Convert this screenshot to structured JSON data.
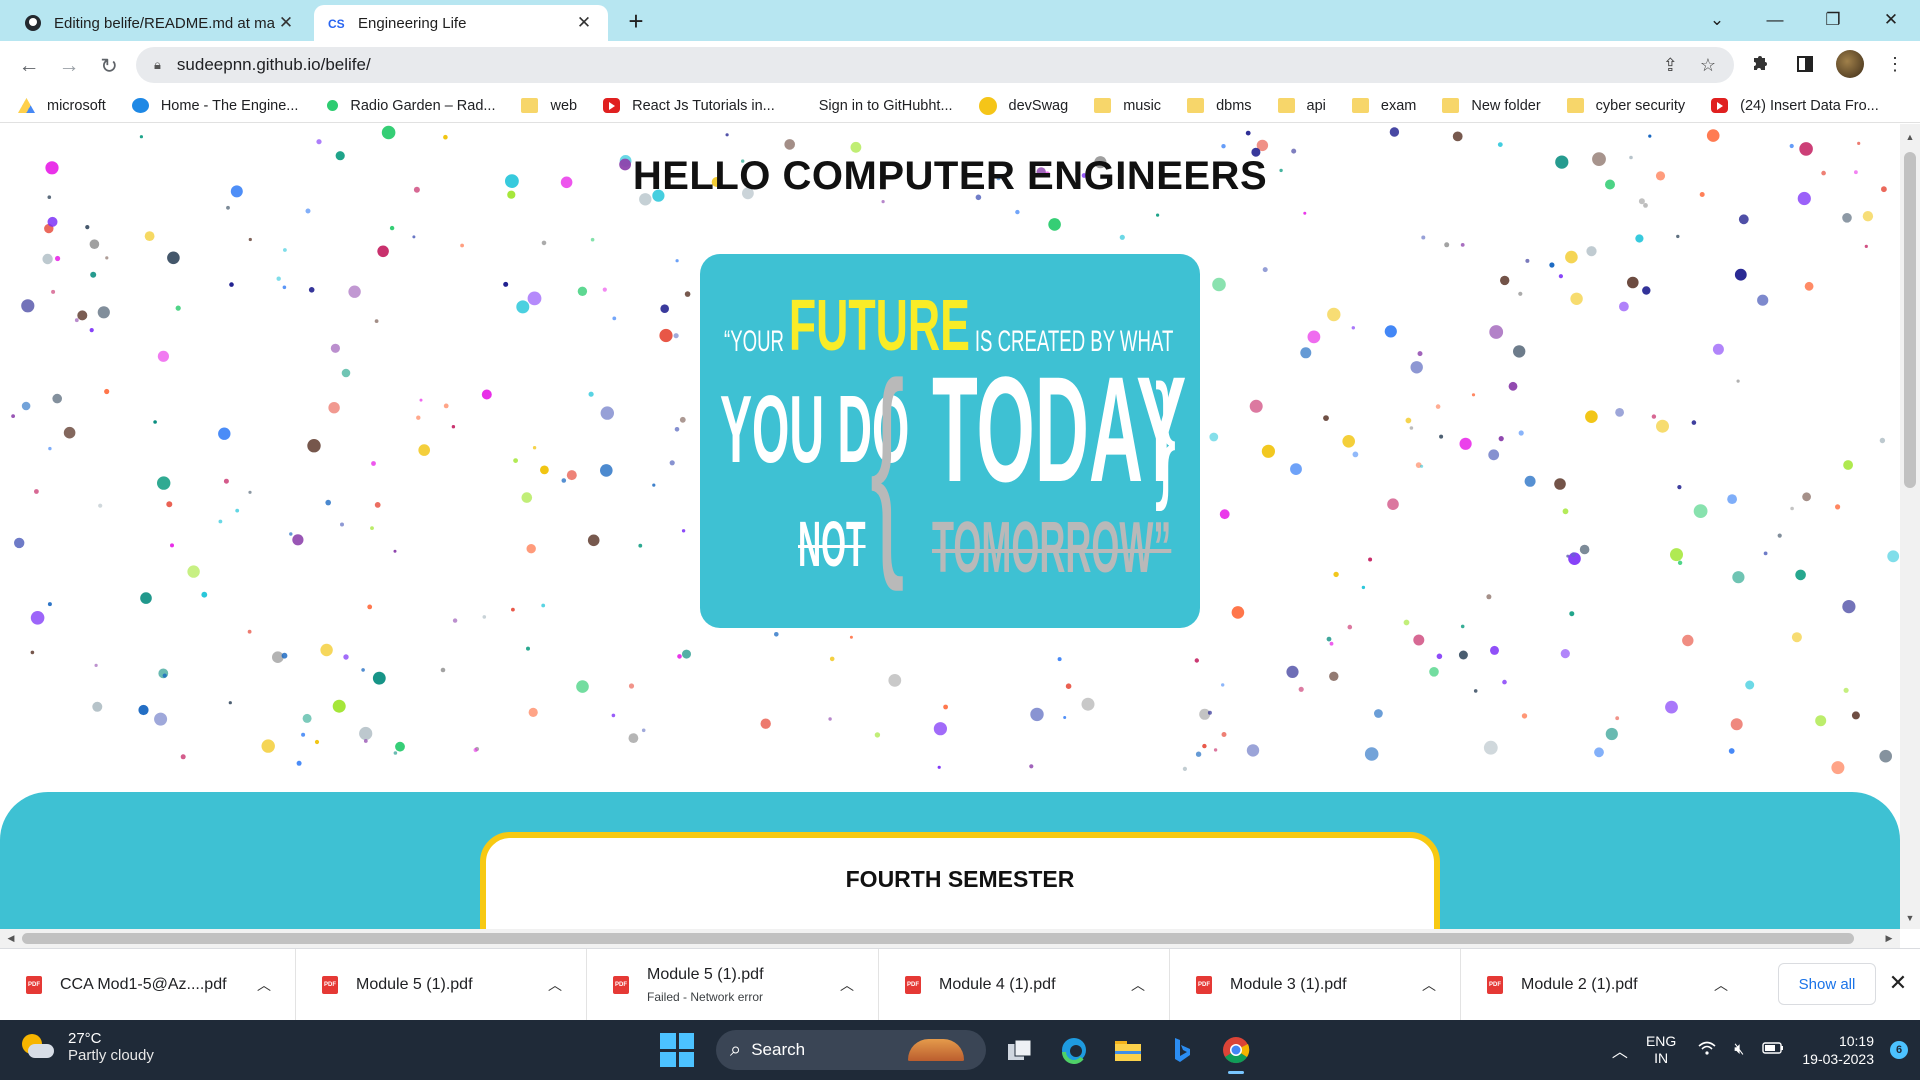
{
  "browser": {
    "tabs": [
      {
        "title": "Editing belife/README.md at ma",
        "favicon": "github-icon"
      },
      {
        "title": "Engineering Life",
        "favicon": "css-badge-icon"
      }
    ],
    "new_tab_label": "+",
    "url": "sudeepnn.github.io/belife/"
  },
  "bookmarks": [
    {
      "label": "microsoft",
      "icon": "drive-icon"
    },
    {
      "label": "Home - The Engine...",
      "icon": "site-icon"
    },
    {
      "label": "Radio Garden – Rad...",
      "icon": "radio-icon"
    },
    {
      "label": "web",
      "icon": "folder-icon"
    },
    {
      "label": "React Js Tutorials in...",
      "icon": "youtube-icon"
    },
    {
      "label": "Sign in to GitHubht...",
      "icon": "none"
    },
    {
      "label": "devSwag",
      "icon": "emoji-icon"
    },
    {
      "label": "music",
      "icon": "folder-icon"
    },
    {
      "label": "dbms",
      "icon": "folder-icon"
    },
    {
      "label": "api",
      "icon": "folder-icon"
    },
    {
      "label": "exam",
      "icon": "folder-icon"
    },
    {
      "label": "New folder",
      "icon": "folder-icon"
    },
    {
      "label": "cyber security",
      "icon": "folder-icon"
    },
    {
      "label": "(24) Insert Data Fro...",
      "icon": "youtube-icon"
    }
  ],
  "page": {
    "heading": "HELLO COMPUTER ENGINEERS",
    "quote": {
      "line1_pre": "“YOUR",
      "line1_highlight": "FUTURE",
      "line1_post": "IS CREATED BY WHAT",
      "you_do": "YOU DO",
      "brace_open": "{",
      "brace_close": "}",
      "today": "TODAY",
      "not": "NOT",
      "tomorrow": "TOMORROW”"
    },
    "section_card_title": "FOURTH SEMESTER"
  },
  "downloads": [
    {
      "name": "CCA Mod1-5@Az....pdf",
      "status": ""
    },
    {
      "name": "Module 5 (1).pdf",
      "status": ""
    },
    {
      "name": "Module 5 (1).pdf",
      "status": "Failed - Network error"
    },
    {
      "name": "Module 4 (1).pdf",
      "status": ""
    },
    {
      "name": "Module 3 (1).pdf",
      "status": ""
    },
    {
      "name": "Module 2 (1).pdf",
      "status": ""
    }
  ],
  "downloads_show_all": "Show all",
  "taskbar": {
    "weather_temp": "27°C",
    "weather_desc": "Partly cloudy",
    "search_label": "Search",
    "lang_line1": "ENG",
    "lang_line2": "IN",
    "time": "10:19",
    "date": "19-03-2023",
    "notification_count": "6"
  },
  "colors": {
    "accent_teal": "#3ec1d3",
    "accent_yellow": "#f7c912",
    "future_yellow": "#f9ec27"
  }
}
